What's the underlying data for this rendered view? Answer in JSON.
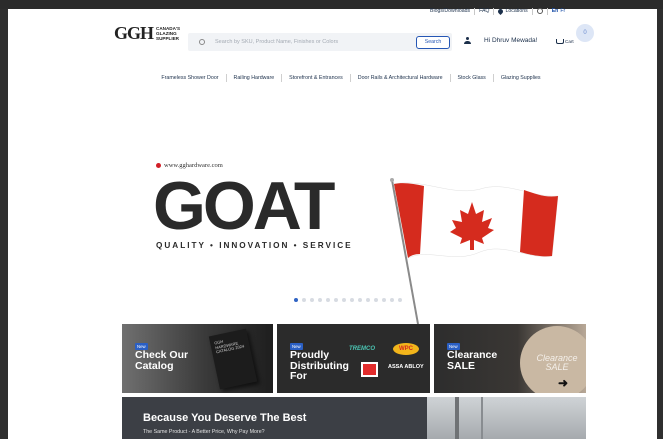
{
  "utility_bar": {
    "links": [
      "Blogs/Downloads",
      "FAQ",
      "Locations"
    ],
    "lang_en": "En",
    "lang_fr": "Fr"
  },
  "header": {
    "logo_mark": "GGH",
    "logo_tagline": [
      "CANADA'S",
      "GLAZING",
      "SUPPLIER"
    ],
    "search_placeholder": "Search by SKU, Product Name, Finishes or Colors",
    "search_button": "Search",
    "user_greeting": "Hi Dhruv Mewada!",
    "cart_label": "Cart",
    "cart_count": "0"
  },
  "nav": {
    "items": [
      "Frameless Shower Door",
      "Railing Hardware",
      "Storefront & Entrances",
      "Door Rails & Architectural Hardware",
      "Stock Glass",
      "Glazing Supplies"
    ]
  },
  "hero": {
    "website": "www.gghardware.com",
    "headline": "GOAT",
    "tagline": "QUALITY • INNOVATION • SERVICE",
    "slide_count": 14,
    "active_slide": 1
  },
  "cards": [
    {
      "badge": "New",
      "title_line1": "Check Our",
      "title_line2": "Catalog",
      "book_text": "GGH HARDWARE CATALOG 2024"
    },
    {
      "badge": "New",
      "title_line1": "Proudly",
      "title_line2": "Distributing",
      "title_line3": "For",
      "brands": [
        "TREMCO",
        "WPC",
        "ASSA ABLOY"
      ]
    },
    {
      "badge": "New",
      "title_line1": "Clearance",
      "title_line2": "SALE",
      "disc_line1": "Clearance",
      "disc_line2": "SALE"
    }
  ],
  "banner": {
    "title": "Because You Deserve The Best",
    "subtitle": "The Same Product - A Better Price, Why Pay More?"
  },
  "colors": {
    "accent": "#2657b5",
    "text_dark": "#1b2f4a",
    "flag_red": "#d52b1e"
  }
}
